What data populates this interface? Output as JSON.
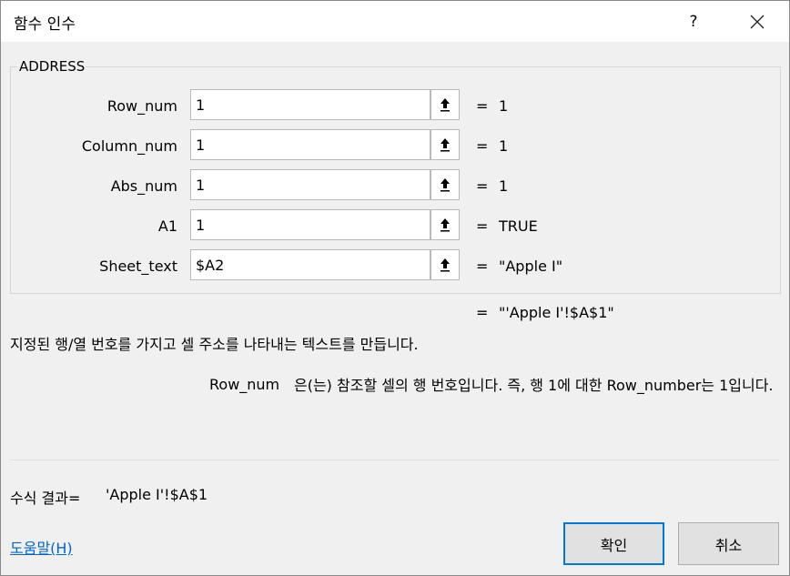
{
  "titlebar": {
    "title": "함수 인수",
    "help_label": "?"
  },
  "group": {
    "title": "ADDRESS"
  },
  "arguments": [
    {
      "label": "Row_num",
      "value": "1",
      "result": "1"
    },
    {
      "label": "Column_num",
      "value": "1",
      "result": "1"
    },
    {
      "label": "Abs_num",
      "value": "1",
      "result": "1"
    },
    {
      "label": "A1",
      "value": "1",
      "result": "TRUE"
    },
    {
      "label": "Sheet_text",
      "value": "$A2",
      "result": "\"Apple I\""
    }
  ],
  "equals_sign": "=",
  "overall_result": "\"'Apple I'!$A$1\"",
  "function_description": "지정된 행/열 번호를 가지고 셀 주소를 나타내는 텍스트를 만듭니다.",
  "argument_help": {
    "name": "Row_num",
    "text": "은(는) 참조할 셀의 행 번호입니다. 즉, 행 1에 대한 Row_number는 1입니다."
  },
  "formula_result": {
    "label": "수식 결과=",
    "value": "'Apple I'!$A$1"
  },
  "help_link": "도움말(H)",
  "buttons": {
    "ok": "확인",
    "cancel": "취소"
  },
  "icons": {
    "ref": "collapse-dialog-icon",
    "close": "close-icon"
  }
}
